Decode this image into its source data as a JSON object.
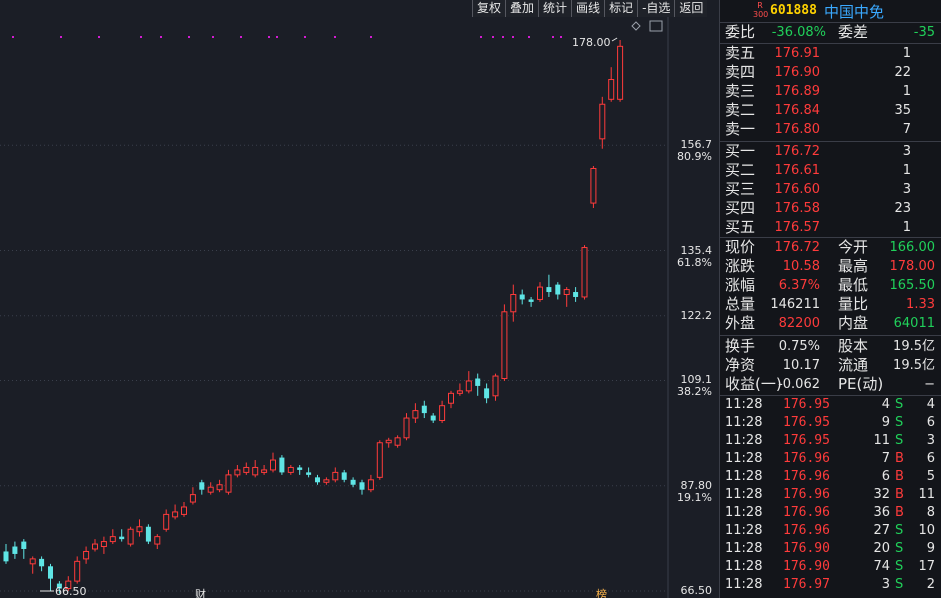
{
  "toolbar": {
    "buttons": [
      "复权",
      "叠加",
      "统计",
      "画线",
      "标记",
      "-自选",
      "返回"
    ]
  },
  "chart": {
    "price_axis": [
      {
        "price": "156.7",
        "pct": "80.9%"
      },
      {
        "price": "135.4",
        "pct": "61.8%"
      },
      {
        "price": "122.2",
        "pct": ""
      },
      {
        "price": "109.1",
        "pct": "38.2%"
      },
      {
        "price": "87.80",
        "pct": "19.1%"
      },
      {
        "price": "66.50",
        "pct": ""
      }
    ],
    "high_label": "178.00",
    "low_label": "66.50",
    "event_marker_1": "财",
    "event_marker_2": "榜",
    "up_color": "#ff3b3b",
    "down_color": "#5fe5e5",
    "marker_dot_color": "#d21bd2"
  },
  "chart_data": {
    "type": "candlestick",
    "ylim": [
      66.5,
      178.0
    ],
    "candles": [
      {
        "o": 74.5,
        "c": 72.5,
        "h": 76.0,
        "l": 72.0
      },
      {
        "o": 75.5,
        "c": 74.0,
        "h": 76.5,
        "l": 73.0
      },
      {
        "o": 76.5,
        "c": 75.0,
        "h": 77.0,
        "l": 73.0
      },
      {
        "o": 72.0,
        "c": 73.0,
        "h": 73.5,
        "l": 70.0
      },
      {
        "o": 73.0,
        "c": 71.5,
        "h": 73.5,
        "l": 70.5
      },
      {
        "o": 71.5,
        "c": 69.0,
        "h": 72.0,
        "l": 66.5
      },
      {
        "o": 68.0,
        "c": 67.0,
        "h": 68.5,
        "l": 66.0
      },
      {
        "o": 67.0,
        "c": 68.5,
        "h": 69.5,
        "l": 66.5
      },
      {
        "o": 68.5,
        "c": 72.5,
        "h": 73.5,
        "l": 68.0
      },
      {
        "o": 73.0,
        "c": 74.5,
        "h": 75.5,
        "l": 72.0
      },
      {
        "o": 75.0,
        "c": 76.0,
        "h": 77.0,
        "l": 74.5
      },
      {
        "o": 75.5,
        "c": 76.5,
        "h": 77.5,
        "l": 74.0
      },
      {
        "o": 76.5,
        "c": 77.5,
        "h": 79.0,
        "l": 76.0
      },
      {
        "o": 77.5,
        "c": 77.0,
        "h": 79.0,
        "l": 76.5
      },
      {
        "o": 76.0,
        "c": 79.0,
        "h": 79.5,
        "l": 75.5
      },
      {
        "o": 78.5,
        "c": 79.5,
        "h": 81.0,
        "l": 77.5
      },
      {
        "o": 79.5,
        "c": 76.5,
        "h": 80.0,
        "l": 76.0
      },
      {
        "o": 76.0,
        "c": 77.5,
        "h": 78.0,
        "l": 75.0
      },
      {
        "o": 79.0,
        "c": 82.0,
        "h": 83.0,
        "l": 78.5
      },
      {
        "o": 81.5,
        "c": 82.5,
        "h": 84.0,
        "l": 81.0
      },
      {
        "o": 82.0,
        "c": 83.5,
        "h": 84.5,
        "l": 81.5
      },
      {
        "o": 84.5,
        "c": 86.0,
        "h": 87.5,
        "l": 84.0
      },
      {
        "o": 88.5,
        "c": 87.0,
        "h": 89.0,
        "l": 86.0
      },
      {
        "o": 86.5,
        "c": 87.5,
        "h": 88.5,
        "l": 86.0
      },
      {
        "o": 87.0,
        "c": 88.0,
        "h": 89.0,
        "l": 86.5
      },
      {
        "o": 86.5,
        "c": 90.0,
        "h": 91.0,
        "l": 86.0
      },
      {
        "o": 90.0,
        "c": 91.0,
        "h": 92.0,
        "l": 89.5
      },
      {
        "o": 90.5,
        "c": 91.5,
        "h": 92.5,
        "l": 90.0
      },
      {
        "o": 90.0,
        "c": 91.5,
        "h": 93.0,
        "l": 89.5
      },
      {
        "o": 90.5,
        "c": 91.0,
        "h": 92.0,
        "l": 90.0
      },
      {
        "o": 91.0,
        "c": 93.0,
        "h": 94.5,
        "l": 90.5
      },
      {
        "o": 93.5,
        "c": 90.5,
        "h": 94.0,
        "l": 90.0
      },
      {
        "o": 90.5,
        "c": 91.5,
        "h": 92.0,
        "l": 90.0
      },
      {
        "o": 91.5,
        "c": 91.0,
        "h": 92.0,
        "l": 90.0
      },
      {
        "o": 90.5,
        "c": 90.0,
        "h": 91.5,
        "l": 89.5
      },
      {
        "o": 89.5,
        "c": 88.5,
        "h": 90.0,
        "l": 88.0
      },
      {
        "o": 88.5,
        "c": 89.0,
        "h": 89.5,
        "l": 88.0
      },
      {
        "o": 89.0,
        "c": 90.5,
        "h": 91.5,
        "l": 88.5
      },
      {
        "o": 90.5,
        "c": 89.0,
        "h": 91.0,
        "l": 88.5
      },
      {
        "o": 89.0,
        "c": 88.0,
        "h": 89.5,
        "l": 87.5
      },
      {
        "o": 88.5,
        "c": 87.0,
        "h": 89.0,
        "l": 86.0
      },
      {
        "o": 87.0,
        "c": 89.0,
        "h": 90.0,
        "l": 86.5
      },
      {
        "o": 89.5,
        "c": 96.5,
        "h": 97.0,
        "l": 89.0
      },
      {
        "o": 96.5,
        "c": 97.0,
        "h": 97.5,
        "l": 95.5
      },
      {
        "o": 96.0,
        "c": 97.5,
        "h": 98.0,
        "l": 95.5
      },
      {
        "o": 97.5,
        "c": 101.5,
        "h": 102.5,
        "l": 97.0
      },
      {
        "o": 101.5,
        "c": 103.0,
        "h": 104.5,
        "l": 100.5
      },
      {
        "o": 104.0,
        "c": 102.5,
        "h": 105.0,
        "l": 101.5
      },
      {
        "o": 102.0,
        "c": 101.0,
        "h": 102.5,
        "l": 100.5
      },
      {
        "o": 101.0,
        "c": 104.0,
        "h": 105.0,
        "l": 100.5
      },
      {
        "o": 104.5,
        "c": 106.5,
        "h": 107.0,
        "l": 103.5
      },
      {
        "o": 106.5,
        "c": 107.0,
        "h": 108.5,
        "l": 106.0
      },
      {
        "o": 107.0,
        "c": 109.0,
        "h": 111.0,
        "l": 106.5
      },
      {
        "o": 109.5,
        "c": 108.0,
        "h": 110.5,
        "l": 106.0
      },
      {
        "o": 107.5,
        "c": 105.5,
        "h": 108.5,
        "l": 104.5
      },
      {
        "o": 106.0,
        "c": 110.0,
        "h": 110.5,
        "l": 105.0
      },
      {
        "o": 109.5,
        "c": 123.0,
        "h": 124.5,
        "l": 109.0
      },
      {
        "o": 123.0,
        "c": 126.5,
        "h": 128.5,
        "l": 121.0
      },
      {
        "o": 126.5,
        "c": 125.5,
        "h": 127.5,
        "l": 124.5
      },
      {
        "o": 125.5,
        "c": 125.0,
        "h": 126.0,
        "l": 124.0
      },
      {
        "o": 125.5,
        "c": 128.0,
        "h": 129.0,
        "l": 125.0
      },
      {
        "o": 128.0,
        "c": 127.0,
        "h": 130.5,
        "l": 126.0
      },
      {
        "o": 128.5,
        "c": 126.5,
        "h": 129.0,
        "l": 125.5
      },
      {
        "o": 126.5,
        "c": 127.5,
        "h": 128.0,
        "l": 124.0
      },
      {
        "o": 127.0,
        "c": 126.0,
        "h": 128.0,
        "l": 125.0
      },
      {
        "o": 126.0,
        "c": 136.0,
        "h": 136.5,
        "l": 125.5
      },
      {
        "o": 145.0,
        "c": 152.0,
        "h": 152.5,
        "l": 144.0
      },
      {
        "o": 158.0,
        "c": 165.0,
        "h": 166.5,
        "l": 156.0
      },
      {
        "o": 166.0,
        "c": 170.0,
        "h": 172.5,
        "l": 165.5
      },
      {
        "o": 166.0,
        "c": 176.72,
        "h": 178.0,
        "l": 165.5
      }
    ]
  },
  "quote": {
    "r300": "R\n300",
    "code": "601888",
    "name": "中国中免",
    "weibi_label": "委比",
    "weibi": "-36.08%",
    "weicha_label": "委差",
    "weicha": "-35",
    "asks": [
      {
        "label": "卖五",
        "price": "176.91",
        "vol": "1"
      },
      {
        "label": "卖四",
        "price": "176.90",
        "vol": "22"
      },
      {
        "label": "卖三",
        "price": "176.89",
        "vol": "1"
      },
      {
        "label": "卖二",
        "price": "176.84",
        "vol": "35"
      },
      {
        "label": "卖一",
        "price": "176.80",
        "vol": "7"
      }
    ],
    "bids": [
      {
        "label": "买一",
        "price": "176.72",
        "vol": "3"
      },
      {
        "label": "买二",
        "price": "176.61",
        "vol": "1"
      },
      {
        "label": "买三",
        "price": "176.60",
        "vol": "3"
      },
      {
        "label": "买四",
        "price": "176.58",
        "vol": "23"
      },
      {
        "label": "买五",
        "price": "176.57",
        "vol": "1"
      }
    ],
    "stats": [
      {
        "l1": "现价",
        "v1": "176.72",
        "c1": "red",
        "l2": "今开",
        "v2": "166.00",
        "c2": "green"
      },
      {
        "l1": "涨跌",
        "v1": "10.58",
        "c1": "red",
        "l2": "最高",
        "v2": "178.00",
        "c2": "red"
      },
      {
        "l1": "涨幅",
        "v1": "6.37%",
        "c1": "red",
        "l2": "最低",
        "v2": "165.50",
        "c2": "green"
      },
      {
        "l1": "总量",
        "v1": "146211",
        "c1": "white",
        "l2": "量比",
        "v2": "1.33",
        "c2": "red"
      },
      {
        "l1": "外盘",
        "v1": "82200",
        "c1": "red",
        "l2": "内盘",
        "v2": "64011",
        "c2": "green"
      }
    ],
    "fund": [
      {
        "l1": "换手",
        "v1": "0.75%",
        "l2": "股本",
        "v2": "19.5亿"
      },
      {
        "l1": "净资",
        "v1": "10.17",
        "l2": "流通",
        "v2": "19.5亿"
      },
      {
        "l1": "收益(一)",
        "v1": "-0.062",
        "l2": "PE(动)",
        "v2": "−"
      }
    ],
    "ticks": [
      {
        "time": "11:28",
        "price": "176.95",
        "vol": "4",
        "side": "S",
        "n": "4"
      },
      {
        "time": "11:28",
        "price": "176.95",
        "vol": "9",
        "side": "S",
        "n": "6"
      },
      {
        "time": "11:28",
        "price": "176.95",
        "vol": "11",
        "side": "S",
        "n": "3"
      },
      {
        "time": "11:28",
        "price": "176.96",
        "vol": "7",
        "side": "B",
        "n": "6"
      },
      {
        "time": "11:28",
        "price": "176.96",
        "vol": "6",
        "side": "B",
        "n": "5"
      },
      {
        "time": "11:28",
        "price": "176.96",
        "vol": "32",
        "side": "B",
        "n": "11"
      },
      {
        "time": "11:28",
        "price": "176.96",
        "vol": "36",
        "side": "B",
        "n": "8"
      },
      {
        "time": "11:28",
        "price": "176.96",
        "vol": "27",
        "side": "S",
        "n": "10"
      },
      {
        "time": "11:28",
        "price": "176.90",
        "vol": "20",
        "side": "S",
        "n": "9"
      },
      {
        "time": "11:28",
        "price": "176.90",
        "vol": "74",
        "side": "S",
        "n": "17"
      },
      {
        "time": "11:28",
        "price": "176.97",
        "vol": "3",
        "side": "S",
        "n": "2"
      }
    ]
  }
}
